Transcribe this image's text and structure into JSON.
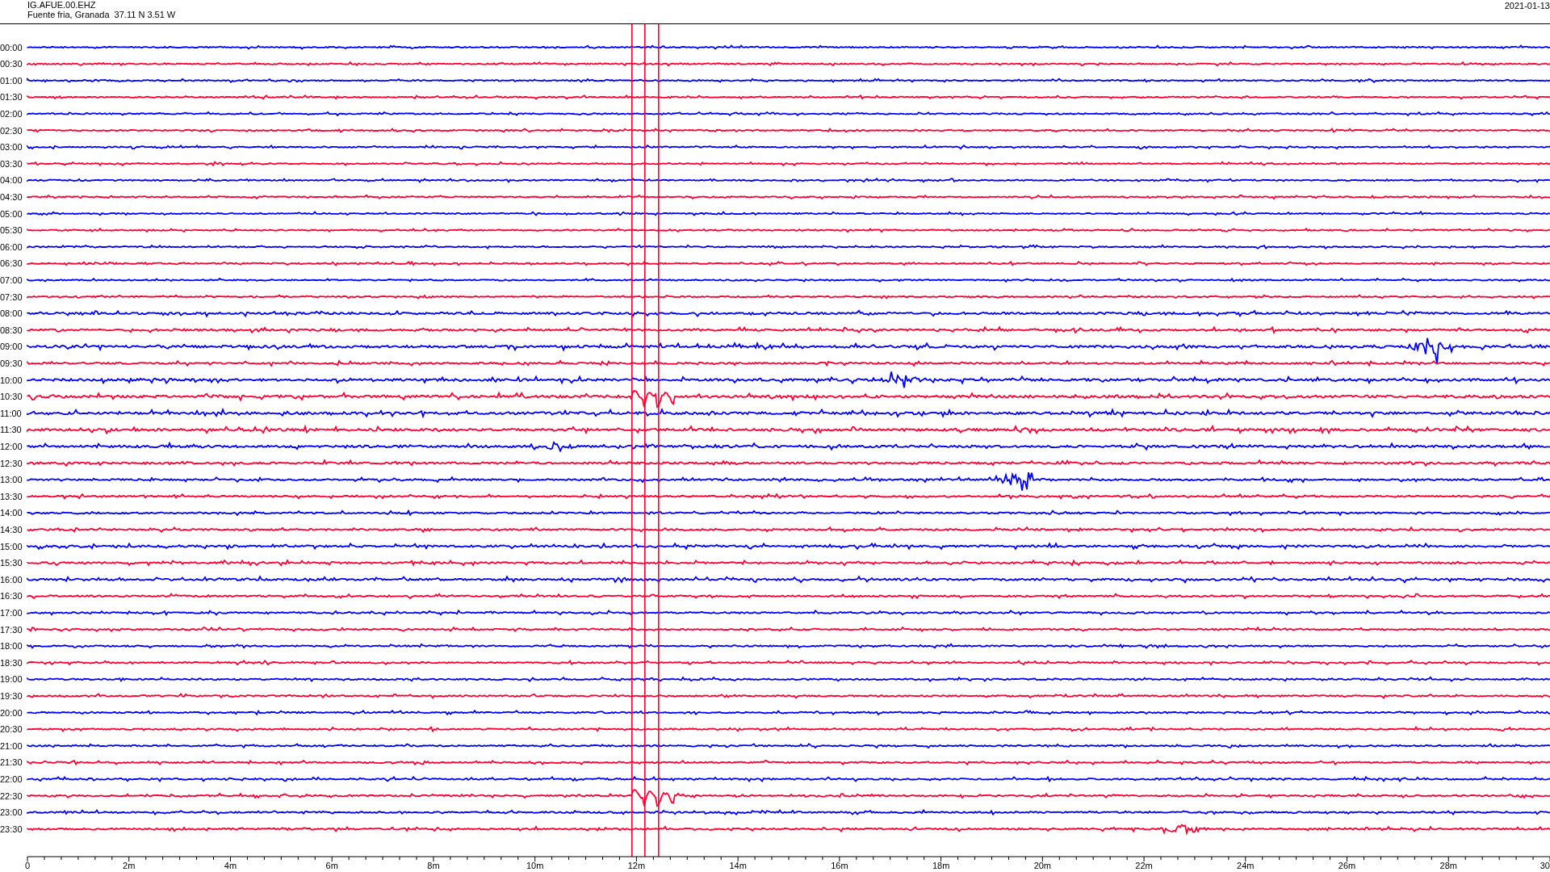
{
  "header": {
    "station": "IG.AFUE.00.EHZ",
    "location": "Fuente fria, Granada  37.11 N 3.51 W",
    "date": "2021-01-13"
  },
  "rows": [
    {
      "time": "00:00",
      "color": "#0000ff"
    },
    {
      "time": "00:30",
      "color": "#ff0033"
    },
    {
      "time": "01:00",
      "color": "#0000ff"
    },
    {
      "time": "01:30",
      "color": "#ff0033"
    },
    {
      "time": "02:00",
      "color": "#0000ff"
    },
    {
      "time": "02:30",
      "color": "#ff0033"
    },
    {
      "time": "03:00",
      "color": "#0000ff"
    },
    {
      "time": "03:30",
      "color": "#ff0033"
    },
    {
      "time": "04:00",
      "color": "#0000ff"
    },
    {
      "time": "04:30",
      "color": "#ff0033"
    },
    {
      "time": "05:00",
      "color": "#0000ff"
    },
    {
      "time": "05:30",
      "color": "#ff0033"
    },
    {
      "time": "06:00",
      "color": "#0000ff"
    },
    {
      "time": "06:30",
      "color": "#ff0033"
    },
    {
      "time": "07:00",
      "color": "#0000ff"
    },
    {
      "time": "07:30",
      "color": "#ff0033"
    },
    {
      "time": "08:00",
      "color": "#0000ff"
    },
    {
      "time": "08:30",
      "color": "#ff0033"
    },
    {
      "time": "09:00",
      "color": "#0000ff"
    },
    {
      "time": "09:30",
      "color": "#ff0033"
    },
    {
      "time": "10:00",
      "color": "#0000ff"
    },
    {
      "time": "10:30",
      "color": "#ff0033"
    },
    {
      "time": "11:00",
      "color": "#0000ff"
    },
    {
      "time": "11:30",
      "color": "#ff0033"
    },
    {
      "time": "12:00",
      "color": "#0000ff"
    },
    {
      "time": "12:30",
      "color": "#ff0033"
    },
    {
      "time": "13:00",
      "color": "#0000ff"
    },
    {
      "time": "13:30",
      "color": "#ff0033"
    },
    {
      "time": "14:00",
      "color": "#0000ff"
    },
    {
      "time": "14:30",
      "color": "#ff0033"
    },
    {
      "time": "15:00",
      "color": "#0000ff"
    },
    {
      "time": "15:30",
      "color": "#ff0033"
    },
    {
      "time": "16:00",
      "color": "#0000ff"
    },
    {
      "time": "16:30",
      "color": "#ff0033"
    },
    {
      "time": "17:00",
      "color": "#0000ff"
    },
    {
      "time": "17:30",
      "color": "#ff0033"
    },
    {
      "time": "18:00",
      "color": "#0000ff"
    },
    {
      "time": "18:30",
      "color": "#ff0033"
    },
    {
      "time": "19:00",
      "color": "#0000ff"
    },
    {
      "time": "19:30",
      "color": "#ff0033"
    },
    {
      "time": "20:00",
      "color": "#0000ff"
    },
    {
      "time": "20:30",
      "color": "#ff0033"
    },
    {
      "time": "21:00",
      "color": "#0000ff"
    },
    {
      "time": "21:30",
      "color": "#ff0033"
    },
    {
      "time": "22:00",
      "color": "#0000ff"
    },
    {
      "time": "22:30",
      "color": "#ff0033"
    },
    {
      "time": "23:00",
      "color": "#0000ff"
    },
    {
      "time": "23:30",
      "color": "#ff0033"
    }
  ],
  "x_axis": {
    "ticks": [
      "0",
      "2m",
      "4m",
      "6m",
      "8m",
      "10m",
      "12m",
      "14m",
      "16m",
      "18m",
      "20m",
      "22m",
      "24m",
      "26m",
      "28m",
      "30"
    ]
  }
}
